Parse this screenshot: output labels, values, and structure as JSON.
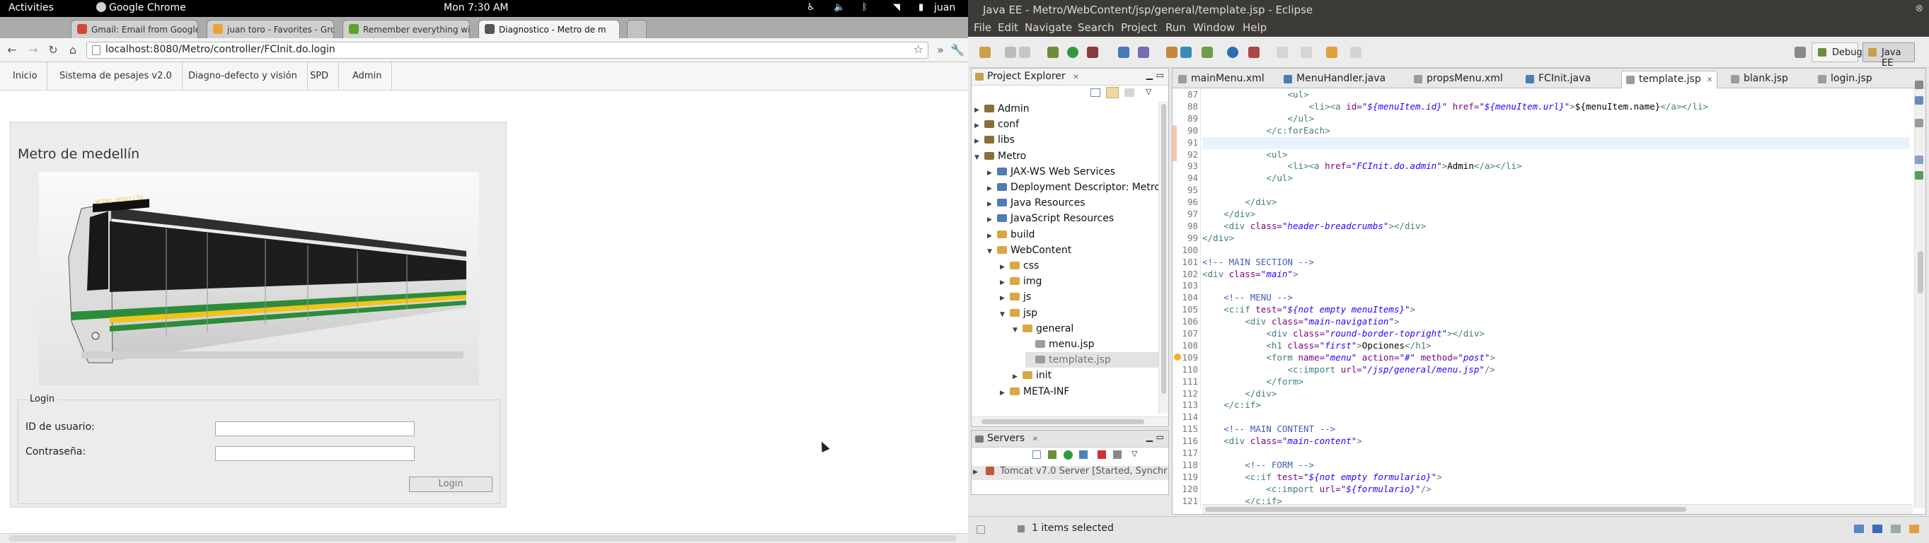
{
  "topbar": {
    "activities": "Activities",
    "app": "Google Chrome",
    "clock": "Mon  7:30 AM",
    "user": "juan"
  },
  "chrome": {
    "tabs": [
      {
        "label": "Gmail: Email from Google",
        "color": "#d14836"
      },
      {
        "label": "juan toro - Favorites - Grc",
        "color": "#e8a33c"
      },
      {
        "label": "Remember everything wi",
        "color": "#5ba525"
      },
      {
        "label": "Diagnostico - Metro de m",
        "color": "#555555"
      }
    ],
    "url": "localhost:8080/Metro/controller/FCInit.do.login"
  },
  "site": {
    "nav": [
      "Inicio",
      "Sistema de pesajes v2.0",
      "Diagno-defecto y visión",
      "SPD",
      "Admin"
    ],
    "title": "Metro de medellín",
    "train_sign": "METRO MEDELLIN",
    "login": {
      "legend": "Login",
      "user_label": "ID de usuario:",
      "pass_label": "Contraseña:",
      "button": "Login"
    }
  },
  "eclipse": {
    "title": "Java EE - Metro/WebContent/jsp/general/template.jsp - Eclipse",
    "menu": [
      "File",
      "Edit",
      "Navigate",
      "Search",
      "Project",
      "Run",
      "Window",
      "Help"
    ],
    "perspectives": [
      "Debug",
      "Java EE"
    ],
    "project_explorer": {
      "title": "Project Explorer",
      "items": [
        {
          "label": "Admin",
          "depth": 0,
          "open": false,
          "kind": "project"
        },
        {
          "label": "conf",
          "depth": 0,
          "open": false,
          "kind": "project"
        },
        {
          "label": "libs",
          "depth": 0,
          "open": false,
          "kind": "project"
        },
        {
          "label": "Metro",
          "depth": 0,
          "open": true,
          "kind": "project"
        },
        {
          "label": "JAX-WS Web Services",
          "depth": 1,
          "open": false,
          "kind": "node"
        },
        {
          "label": "Deployment Descriptor: Metro",
          "depth": 1,
          "open": false,
          "kind": "node"
        },
        {
          "label": "Java Resources",
          "depth": 1,
          "open": false,
          "kind": "node"
        },
        {
          "label": "JavaScript Resources",
          "depth": 1,
          "open": false,
          "kind": "node"
        },
        {
          "label": "build",
          "depth": 1,
          "open": false,
          "kind": "folder"
        },
        {
          "label": "WebContent",
          "depth": 1,
          "open": true,
          "kind": "folder"
        },
        {
          "label": "css",
          "depth": 2,
          "open": false,
          "kind": "folder"
        },
        {
          "label": "img",
          "depth": 2,
          "open": false,
          "kind": "folder"
        },
        {
          "label": "js",
          "depth": 2,
          "open": false,
          "kind": "folder"
        },
        {
          "label": "jsp",
          "depth": 2,
          "open": true,
          "kind": "folder"
        },
        {
          "label": "general",
          "depth": 3,
          "open": true,
          "kind": "folder"
        },
        {
          "label": "menu.jsp",
          "depth": 4,
          "open": false,
          "kind": "file"
        },
        {
          "label": "template.jsp",
          "depth": 4,
          "open": false,
          "kind": "file",
          "selected": true
        },
        {
          "label": "init",
          "depth": 3,
          "open": false,
          "kind": "folder"
        },
        {
          "label": "META-INF",
          "depth": 2,
          "open": false,
          "kind": "folder"
        }
      ]
    },
    "servers": {
      "title": "Servers",
      "item": "Tomcat v7.0 Server  [Started, Synchr"
    },
    "editor_tabs": [
      {
        "label": "mainMenu.xml",
        "active": false
      },
      {
        "label": "MenuHandler.java",
        "active": false
      },
      {
        "label": "propsMenu.xml",
        "active": false
      },
      {
        "label": "FCInit.java",
        "active": false
      },
      {
        "label": "template.jsp",
        "active": true
      },
      {
        "label": "blank.jsp",
        "active": false
      },
      {
        "label": "login.jsp",
        "active": false
      }
    ],
    "code": [
      {
        "n": "87",
        "t": "                <ul>"
      },
      {
        "n": "88",
        "t": "                    <li><a id=\"${menuItem.id}\" href=\"${menuItem.url}\">${menuItem.name}</a></li>"
      },
      {
        "n": "89",
        "t": "                </ul>"
      },
      {
        "n": "90",
        "t": "            </c:forEach>"
      },
      {
        "n": "91",
        "t": ""
      },
      {
        "n": "92",
        "t": "            <ul>"
      },
      {
        "n": "93",
        "t": "                <li><a href=\"FCInit.do.admin\">Admin</a></li>"
      },
      {
        "n": "94",
        "t": "            </ul>"
      },
      {
        "n": "95",
        "t": ""
      },
      {
        "n": "96",
        "t": "        </div>"
      },
      {
        "n": "97",
        "t": "    </div>"
      },
      {
        "n": "98",
        "t": "    <div class=\"header-breadcrumbs\"></div>"
      },
      {
        "n": "99",
        "t": "</div>"
      },
      {
        "n": "100",
        "t": ""
      },
      {
        "n": "101",
        "t": "<!-- MAIN SECTION -->"
      },
      {
        "n": "102",
        "t": "<div class=\"main\">"
      },
      {
        "n": "103",
        "t": ""
      },
      {
        "n": "104",
        "t": "    <!-- MENU -->"
      },
      {
        "n": "105",
        "t": "    <c:if test=\"${not empty menuItems}\">"
      },
      {
        "n": "106",
        "t": "        <div class=\"main-navigation\">"
      },
      {
        "n": "107",
        "t": "            <div class=\"round-border-topright\"></div>"
      },
      {
        "n": "108",
        "t": "            <h1 class=\"first\">Opciones</h1>"
      },
      {
        "n": "109",
        "t": "            <form name=\"menu\" action=\"#\" method=\"post\">"
      },
      {
        "n": "110",
        "t": "                <c:import url=\"/jsp/general/menu.jsp\"/>"
      },
      {
        "n": "111",
        "t": "            </form>"
      },
      {
        "n": "112",
        "t": "        </div>"
      },
      {
        "n": "113",
        "t": "    </c:if>"
      },
      {
        "n": "114",
        "t": ""
      },
      {
        "n": "115",
        "t": "    <!-- MAIN CONTENT -->"
      },
      {
        "n": "116",
        "t": "    <div class=\"main-content\">"
      },
      {
        "n": "117",
        "t": ""
      },
      {
        "n": "118",
        "t": "        <!-- FORM -->"
      },
      {
        "n": "119",
        "t": "        <c:if test=\"${not empty formulario}\">"
      },
      {
        "n": "120",
        "t": "            <c:import url=\"${formulario}\"/>"
      },
      {
        "n": "121",
        "t": "        </c:if>"
      }
    ],
    "status": "1 items selected"
  }
}
